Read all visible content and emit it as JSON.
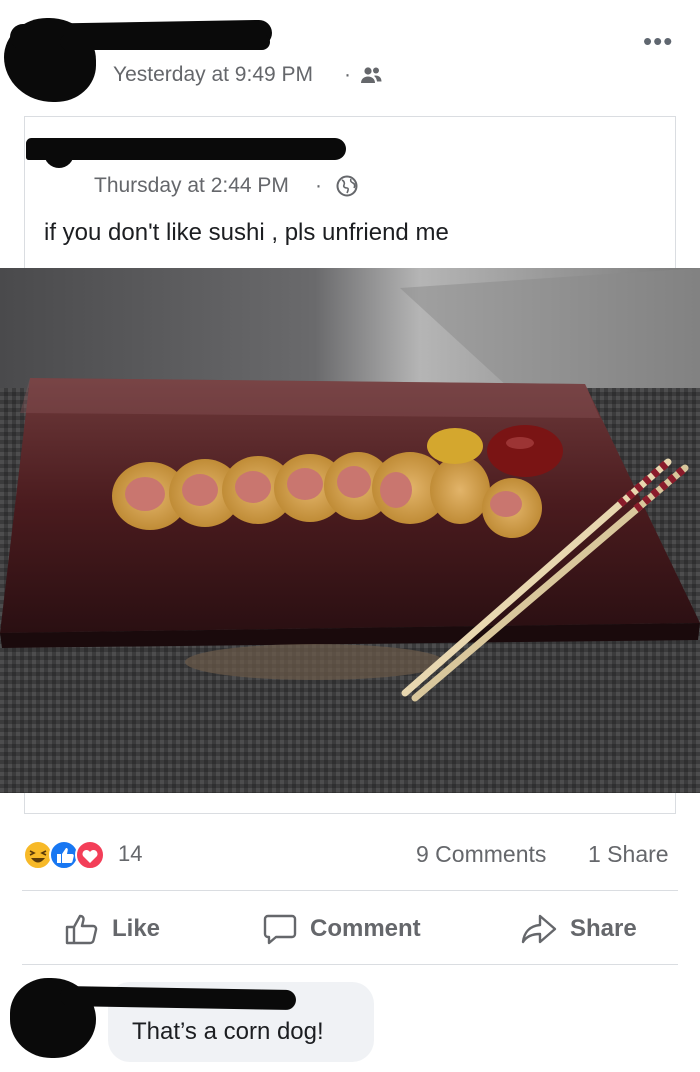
{
  "post": {
    "timestamp": "Yesterday at 9:49 PM",
    "separator": "·",
    "audience_icon": "friends-icon",
    "more_icon": "•••"
  },
  "shared_post": {
    "timestamp": "Thursday at 2:44 PM",
    "separator": "·",
    "audience_icon": "globe-icon",
    "text": "if you don't like sushi , pls unfriend me",
    "photo_description": "Corn dog slices arranged like sushi on a dark rectangular plate with ketchup, mustard and chopsticks"
  },
  "engagement": {
    "reaction_icons": [
      "haha-icon",
      "like-icon",
      "love-icon"
    ],
    "reaction_count": "14",
    "comments": "9 Comments",
    "shares": "1 Share"
  },
  "actions": {
    "like": "Like",
    "comment": "Comment",
    "share": "Share"
  },
  "comment": {
    "text": "That’s a corn dog!"
  },
  "colors": {
    "muted": "#65676b",
    "like_blue": "#1877f2",
    "love_red": "#f33e58",
    "haha_yellow": "#f7b928",
    "bubble": "#f0f2f5"
  }
}
